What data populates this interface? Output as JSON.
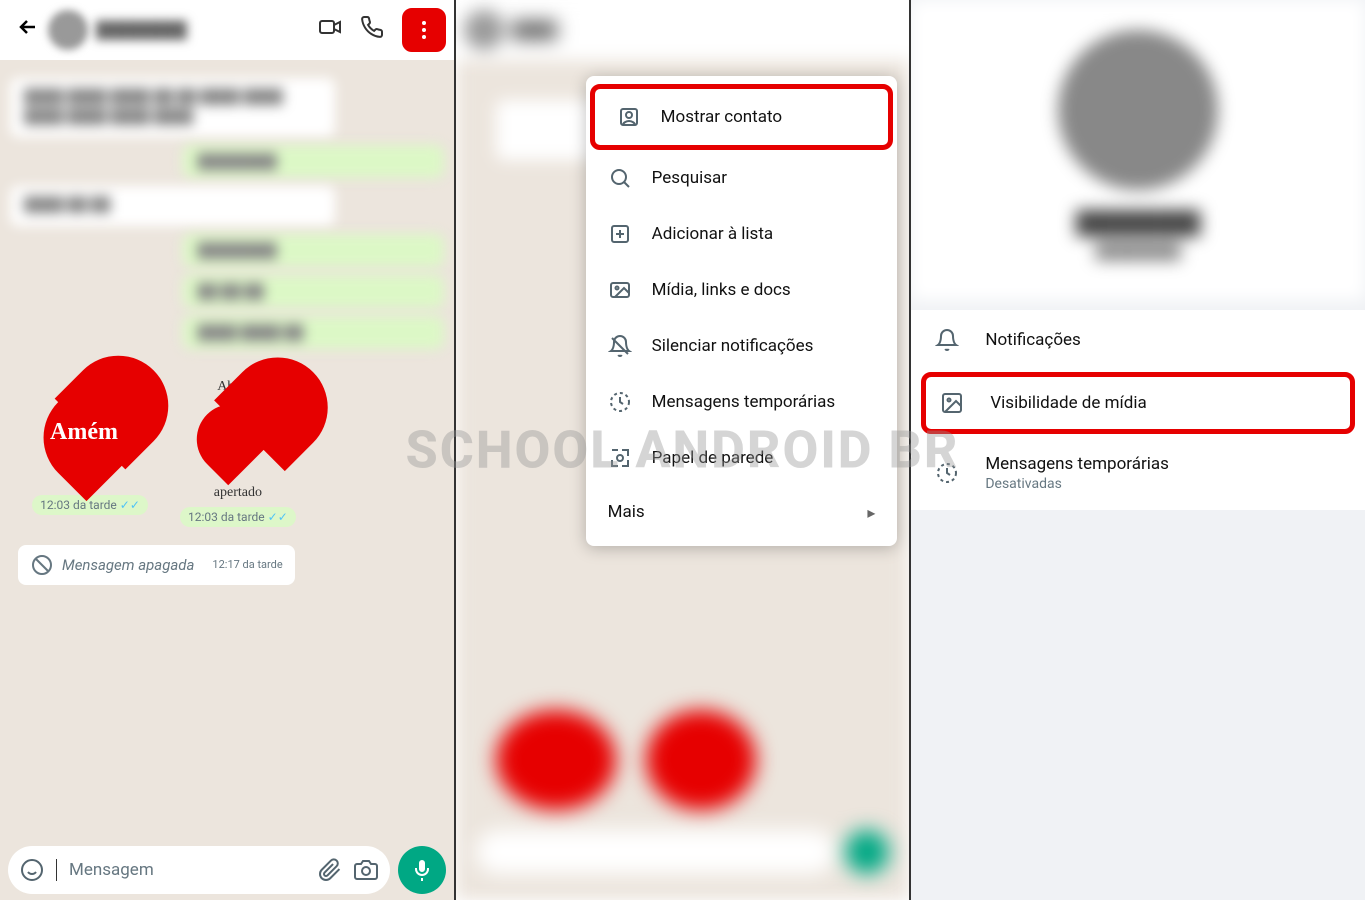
{
  "watermark": "SCHOOL ANDROID BR",
  "panel1": {
    "sticker1_text": "Amém",
    "sticker2_top": "Abraço",
    "sticker2_bot": "apertado",
    "sticker_time": "12:03 da tarde",
    "deleted_label": "Mensagem apagada",
    "deleted_time": "12:17 da tarde",
    "input_placeholder": "Mensagem"
  },
  "panel2": {
    "menu": [
      {
        "label": "Mostrar contato",
        "icon": "contact"
      },
      {
        "label": "Pesquisar",
        "icon": "search"
      },
      {
        "label": "Adicionar à lista",
        "icon": "addlist"
      },
      {
        "label": "Mídia, links e docs",
        "icon": "media"
      },
      {
        "label": "Silenciar notificações",
        "icon": "mute"
      },
      {
        "label": "Mensagens temporárias",
        "icon": "timer"
      },
      {
        "label": "Papel de parede",
        "icon": "wallpaper"
      }
    ],
    "more_label": "Mais"
  },
  "panel3": {
    "settings": {
      "notifications": "Notificações",
      "media_visibility": "Visibilidade de mídia",
      "temp_messages": "Mensagens temporárias",
      "temp_messages_sub": "Desativadas"
    }
  }
}
